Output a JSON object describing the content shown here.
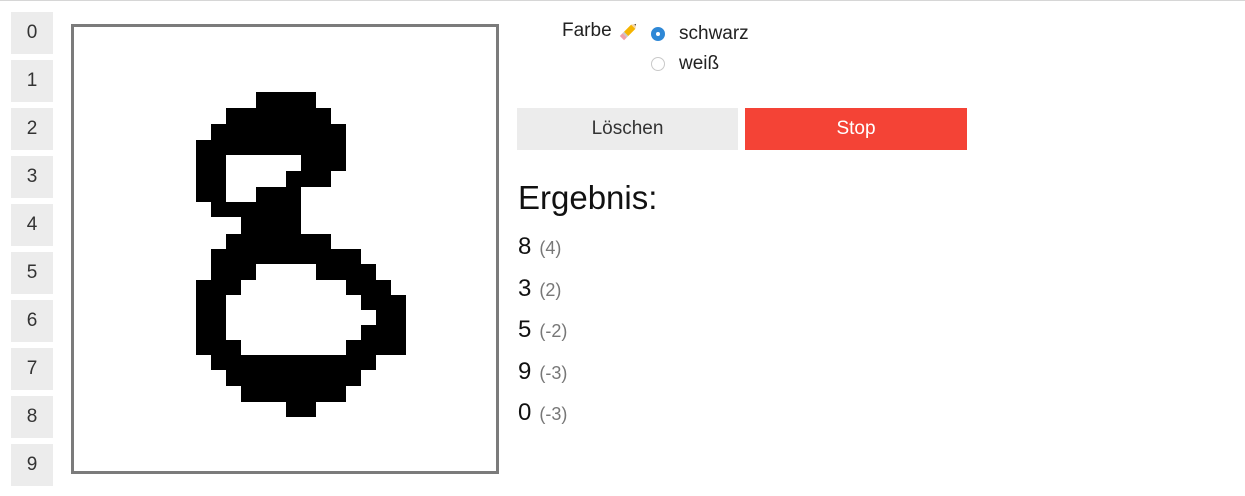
{
  "digit_buttons": [
    "0",
    "1",
    "2",
    "3",
    "4",
    "5",
    "6",
    "7",
    "8",
    "9"
  ],
  "color_picker": {
    "label": "Farbe",
    "options": [
      {
        "label": "schwarz",
        "selected": true
      },
      {
        "label": "weiß",
        "selected": false
      }
    ]
  },
  "actions": {
    "clear_label": "Löschen",
    "stop_label": "Stop",
    "stop_color": "#f44336"
  },
  "results": {
    "title": "Ergebnis:",
    "items": [
      {
        "digit": "8",
        "score": "(4)"
      },
      {
        "digit": "3",
        "score": "(2)"
      },
      {
        "digit": "5",
        "score": "(-2)"
      },
      {
        "digit": "9",
        "score": "(-3)"
      },
      {
        "digit": "0",
        "score": "(-3)"
      }
    ]
  },
  "canvas": {
    "ink_color": "#000000",
    "drawn_digit": "8"
  }
}
